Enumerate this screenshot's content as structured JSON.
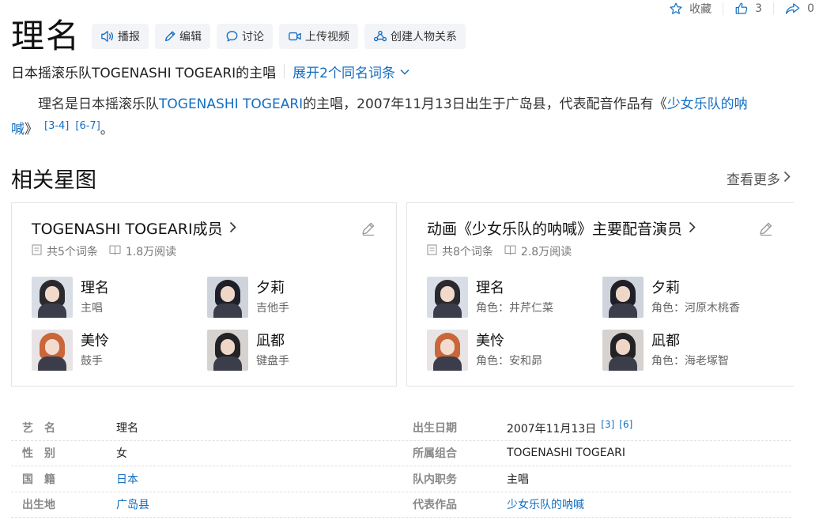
{
  "stats": {
    "collect_label": "收藏",
    "like_count": "3",
    "share_count": "0"
  },
  "entry": {
    "title": "理名",
    "toolbar": {
      "broadcast": "播报",
      "edit": "编辑",
      "discuss": "讨论",
      "upload_video": "上传视频",
      "create_relation": "创建人物关系"
    },
    "subtitle": "日本摇滚乐队TOGENASHI TOGEARI的主唱",
    "expand_label": "展开2个同名词条"
  },
  "summary": {
    "part1": "理名是日本摇滚乐队",
    "link_band": "TOGENASHI TOGEARI",
    "part2": "的主唱，2007年11月13日出生于广岛县，代表配音作品有《",
    "link_work": "少女乐队的呐喊",
    "part3": "》",
    "ref1": "[3-4]",
    "ref2": "[6-7]",
    "end": "。"
  },
  "related": {
    "title": "相关星图",
    "more_label": "查看更多",
    "cards": [
      {
        "title": "TOGENASHI TOGEARI成员",
        "entries": "共5个词条",
        "reads": "1.8万阅读",
        "people": [
          {
            "name": "理名",
            "role": "主唱"
          },
          {
            "name": "夕莉",
            "role": "吉他手"
          },
          {
            "name": "美怜",
            "role": "鼓手"
          },
          {
            "name": "凪都",
            "role": "键盘手"
          }
        ]
      },
      {
        "title": "动画《少女乐队的呐喊》主要配音演员",
        "entries": "共8个词条",
        "reads": "2.8万阅读",
        "people": [
          {
            "name": "理名",
            "role": "角色：井芹仁菜"
          },
          {
            "name": "夕莉",
            "role": "角色：河原木桃香"
          },
          {
            "name": "美怜",
            "role": "角色：安和昴"
          },
          {
            "name": "凪都",
            "role": "角色：海老塚智"
          }
        ]
      }
    ]
  },
  "info": {
    "rows": [
      {
        "k1": "艺名",
        "v1": "理名",
        "k2": "出生日期",
        "v2": "2007年11月13日",
        "r1": "[3]",
        "r2": "[6]"
      },
      {
        "k1": "性别",
        "v1": "女",
        "k2": "所属组合",
        "v2": "TOGENASHI TOGEARI"
      },
      {
        "k1": "国籍",
        "v1": "日本",
        "k2": "队内职务",
        "v2": "主唱"
      },
      {
        "k1": "出生地",
        "v1": "广岛县",
        "k2": "代表作品",
        "v2": "少女乐队的呐喊"
      }
    ]
  },
  "colors": {
    "link": "#136ec2",
    "button_bg": "#f3f4f7"
  }
}
